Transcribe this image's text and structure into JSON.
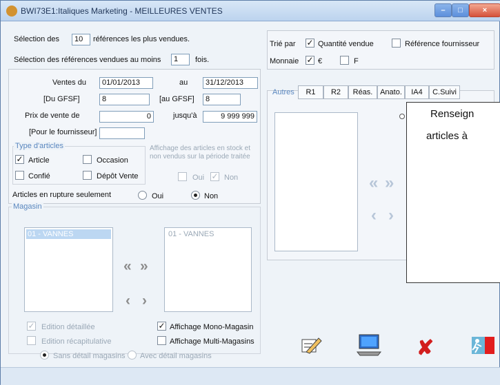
{
  "window": {
    "title": "BWI73E1:Italiques Marketing - MEILLEURES VENTES"
  },
  "selection": {
    "prefix": "Sélection des",
    "count": "10",
    "suffix": "références les plus vendues.",
    "min_prefix": "Sélection des références vendues au moins",
    "min_count": "1",
    "min_suffix": "fois."
  },
  "filters": {
    "sales_from_label": "Ventes du",
    "sales_from": "01/01/2013",
    "sales_to_label": "au",
    "sales_to": "31/12/2013",
    "gsf_from_label": "[Du GFSF]",
    "gsf_from": "8",
    "gsf_to_label": "[au GFSF]",
    "gsf_to": "8",
    "price_label": "Prix de vente de",
    "price_from": "0",
    "price_to_label": "jusqu'à",
    "price_to": "9 999 999",
    "supplier_label": "[Pour le fournisseur]",
    "supplier": ""
  },
  "article_types": {
    "legend": "Type d'articles",
    "article": "Article",
    "occasion": "Occasion",
    "confie": "Confié",
    "depot": "Dépôt Vente",
    "stock_note_1": "Affichage des articles en stock et",
    "stock_note_2": "non vendus sur la période traitée",
    "oui": "Oui",
    "non": "Non"
  },
  "rupture": {
    "label": "Articles en rupture seulement",
    "oui": "Oui",
    "non": "Non"
  },
  "store": {
    "legend": "Magasin",
    "left_item": "01 - VANNES",
    "right_item": "01 - VANNES"
  },
  "options": {
    "detailed": "Edition détaillée",
    "recap": "Edition récapitulative",
    "mono": "Affichage Mono-Magasin",
    "multi": "Affichage Multi-Magasins",
    "no_detail": "Sans détail magasins",
    "with_detail": "Avec détail magasins"
  },
  "sort": {
    "label": "Trié par",
    "qty": "Quantité vendue",
    "supplier_ref": "Référence fournisseur",
    "currency_label": "Monnaie",
    "euro": "€",
    "franc": "F"
  },
  "tabs": [
    "Autres",
    "R1",
    "R2",
    "Réas.",
    "Anato.",
    "IA4",
    "C.Suivi"
  ],
  "tooltip": {
    "line1": "Renseign",
    "line2": "articles à"
  }
}
